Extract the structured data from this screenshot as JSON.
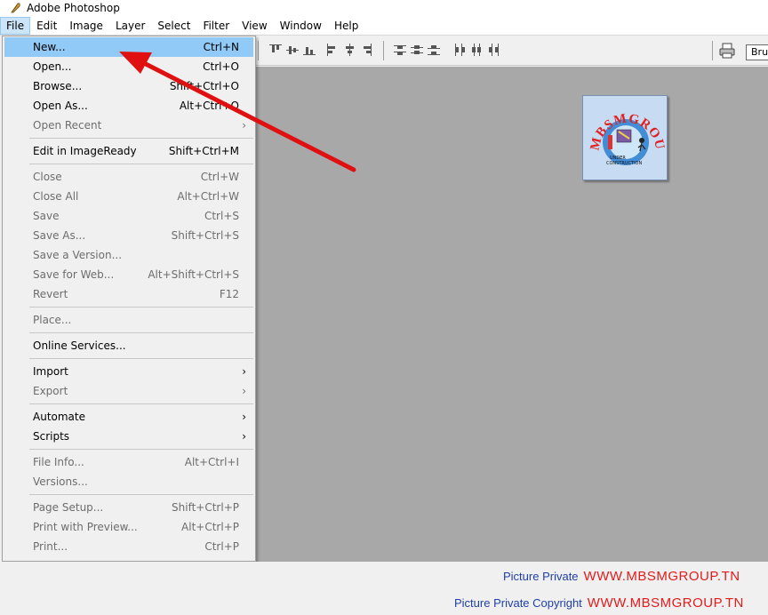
{
  "window": {
    "title": "Adobe Photoshop"
  },
  "menubar": {
    "items": [
      {
        "label": "File",
        "active": true
      },
      {
        "label": "Edit"
      },
      {
        "label": "Image"
      },
      {
        "label": "Layer"
      },
      {
        "label": "Select"
      },
      {
        "label": "Filter"
      },
      {
        "label": "View"
      },
      {
        "label": "Window"
      },
      {
        "label": "Help"
      }
    ]
  },
  "file_menu": {
    "items": [
      {
        "label": "New...",
        "shortcut": "Ctrl+N"
      },
      {
        "label": "Open...",
        "shortcut": "Ctrl+O"
      },
      {
        "label": "Browse...",
        "shortcut": "Shift+Ctrl+O"
      },
      {
        "label": "Open As...",
        "shortcut": "Alt+Ctrl+O"
      },
      {
        "label": "Open Recent",
        "shortcut": ""
      },
      {
        "label": "Edit in ImageReady",
        "shortcut": "Shift+Ctrl+M"
      },
      {
        "label": "Close",
        "shortcut": "Ctrl+W"
      },
      {
        "label": "Close All",
        "shortcut": "Alt+Ctrl+W"
      },
      {
        "label": "Save",
        "shortcut": "Ctrl+S"
      },
      {
        "label": "Save As...",
        "shortcut": "Shift+Ctrl+S"
      },
      {
        "label": "Save a Version...",
        "shortcut": ""
      },
      {
        "label": "Save for Web...",
        "shortcut": "Alt+Shift+Ctrl+S"
      },
      {
        "label": "Revert",
        "shortcut": "F12"
      },
      {
        "label": "Place...",
        "shortcut": ""
      },
      {
        "label": "Online Services...",
        "shortcut": ""
      },
      {
        "label": "Import",
        "shortcut": ""
      },
      {
        "label": "Export",
        "shortcut": ""
      },
      {
        "label": "Automate",
        "shortcut": ""
      },
      {
        "label": "Scripts",
        "shortcut": ""
      },
      {
        "label": "File Info...",
        "shortcut": "Alt+Ctrl+I"
      },
      {
        "label": "Versions...",
        "shortcut": ""
      },
      {
        "label": "Page Setup...",
        "shortcut": "Shift+Ctrl+P"
      },
      {
        "label": "Print with Preview...",
        "shortcut": "Alt+Ctrl+P"
      },
      {
        "label": "Print...",
        "shortcut": "Ctrl+P"
      }
    ],
    "submenu_glyph": "›"
  },
  "options_bar": {
    "brush_label": "Brushes"
  },
  "logo": {
    "arc_text": "MBSMGROUP",
    "line1": "UNDER",
    "line2": "CONSTRUCTION"
  },
  "footer": {
    "line1_label": "Picture Private",
    "line1_url": "WWW.MBSMGROUP.TN",
    "line2_label": "Picture Private Copyright",
    "line2_url": "WWW.MBSMGROUP.TN"
  },
  "colors": {
    "highlight": "#91c9f7",
    "menubar_active": "#cce4f7",
    "workspace": "#a8a8a8",
    "annotation_arrow": "#e01010",
    "footer_label": "#1f3fa8",
    "footer_url": "#e21b1b"
  },
  "icons": {
    "app": "photoshop-feather-icon",
    "printer": "printer-icon",
    "align": "align-icon",
    "distribute": "distribute-icon"
  }
}
